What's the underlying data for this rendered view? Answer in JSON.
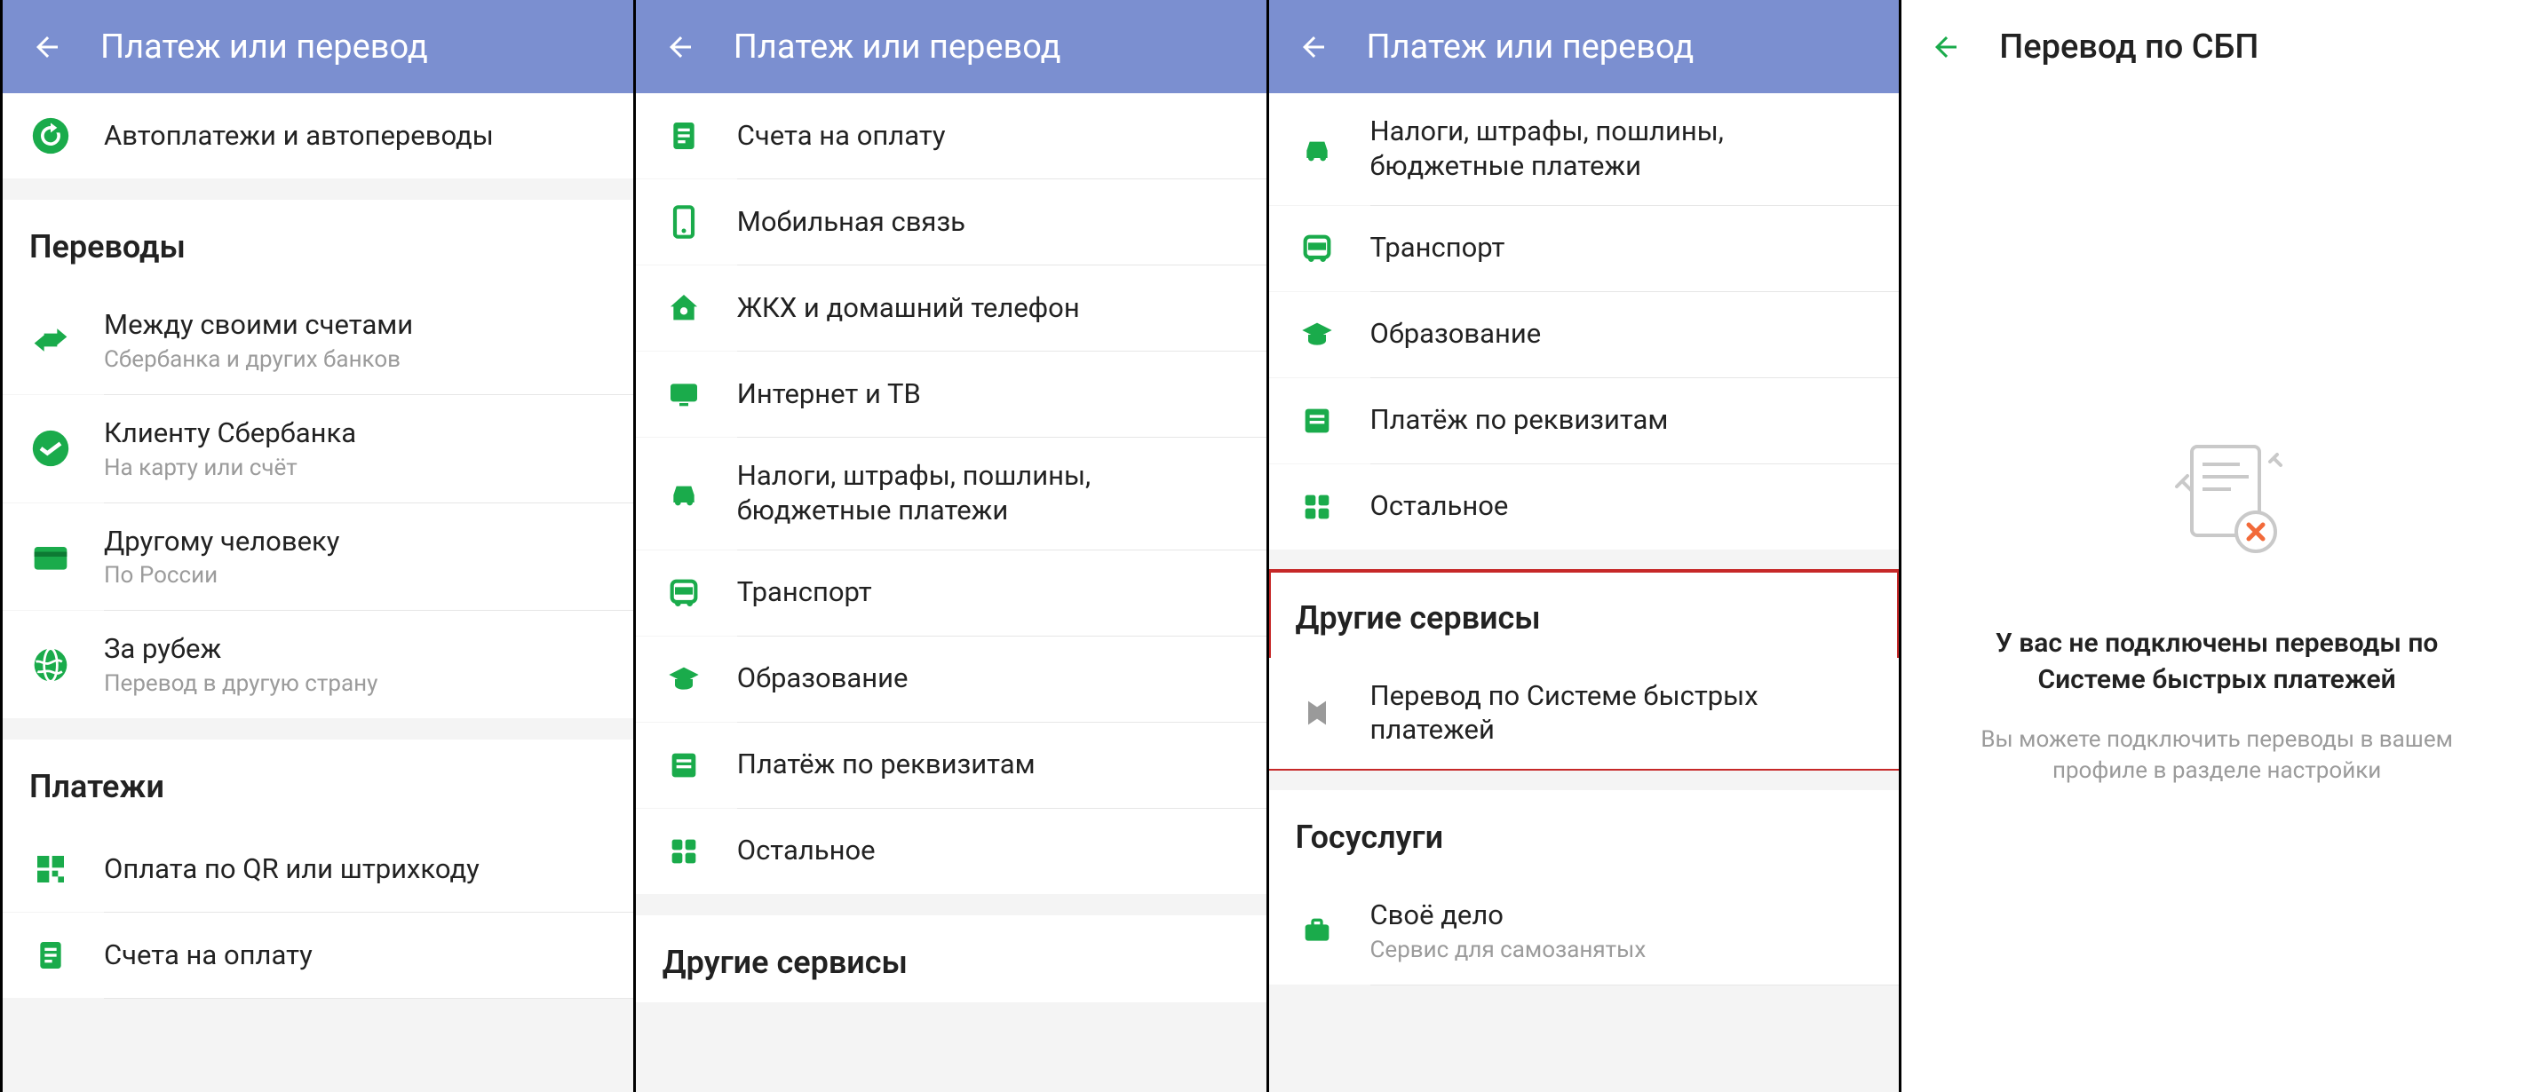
{
  "colors": {
    "primary": "#7b8fd0",
    "accent": "#1aab4b",
    "text": "#222",
    "muted": "#9b9b9b",
    "highlight": "#c62828",
    "error": "#f26a3a"
  },
  "screen1": {
    "title": "Платеж или перевод",
    "top": {
      "label": "Автоплатежи и автопереводы"
    },
    "section_transfers": "Переводы",
    "transfers": [
      {
        "label": "Между своими счетами",
        "sub": "Сбербанка и других банков",
        "icon": "swap-icon"
      },
      {
        "label": "Клиенту Сбербанка",
        "sub": "На карту или счёт",
        "icon": "sber-icon"
      },
      {
        "label": "Другому человеку",
        "sub": "По России",
        "icon": "card-icon"
      },
      {
        "label": "За рубеж",
        "sub": "Перевод в другую страну",
        "icon": "globe-icon"
      }
    ],
    "section_payments": "Платежи",
    "payments": [
      {
        "label": "Оплата по QR или штрихкоду",
        "icon": "qr-icon"
      },
      {
        "label": "Счета на оплату",
        "icon": "invoice-icon"
      }
    ]
  },
  "screen2": {
    "title": "Платеж или перевод",
    "items": [
      {
        "label": "Счета на оплату",
        "icon": "invoice-icon"
      },
      {
        "label": "Мобильная связь",
        "icon": "phone-icon"
      },
      {
        "label": "ЖКХ и домашний телефон",
        "icon": "house-icon"
      },
      {
        "label": "Интернет и ТВ",
        "icon": "internet-icon"
      },
      {
        "label": "Налоги, штрафы, пошлины, бюджетные платежи",
        "icon": "car-icon"
      },
      {
        "label": "Транспорт",
        "icon": "bus-icon"
      },
      {
        "label": "Образование",
        "icon": "education-icon"
      },
      {
        "label": "Платёж по реквизитам",
        "icon": "requisites-icon"
      },
      {
        "label": "Остальное",
        "icon": "grid-icon"
      }
    ],
    "section_other": "Другие сервисы"
  },
  "screen3": {
    "title": "Платеж или перевод",
    "items_top": [
      {
        "label": "Налоги, штрафы, пошлины, бюджетные платежи",
        "icon": "car-icon"
      },
      {
        "label": "Транспорт",
        "icon": "bus-icon"
      },
      {
        "label": "Образование",
        "icon": "education-icon"
      },
      {
        "label": "Платёж по реквизитам",
        "icon": "requisites-icon"
      },
      {
        "label": "Остальное",
        "icon": "grid-icon"
      }
    ],
    "section_other": "Другие сервисы",
    "other": [
      {
        "label": "Перевод по Системе быстрых платежей",
        "icon": "sbp-icon"
      }
    ],
    "section_gos": "Госуслуги",
    "gos": [
      {
        "label": "Своё дело",
        "sub": "Сервис для самозанятых",
        "icon": "briefcase-icon"
      }
    ]
  },
  "screen4": {
    "title": "Перевод по СБП",
    "heading": "У вас не подключены переводы по Системе быстрых платежей",
    "subtext": "Вы можете подключить переводы в вашем профиле в разделе настройки"
  }
}
